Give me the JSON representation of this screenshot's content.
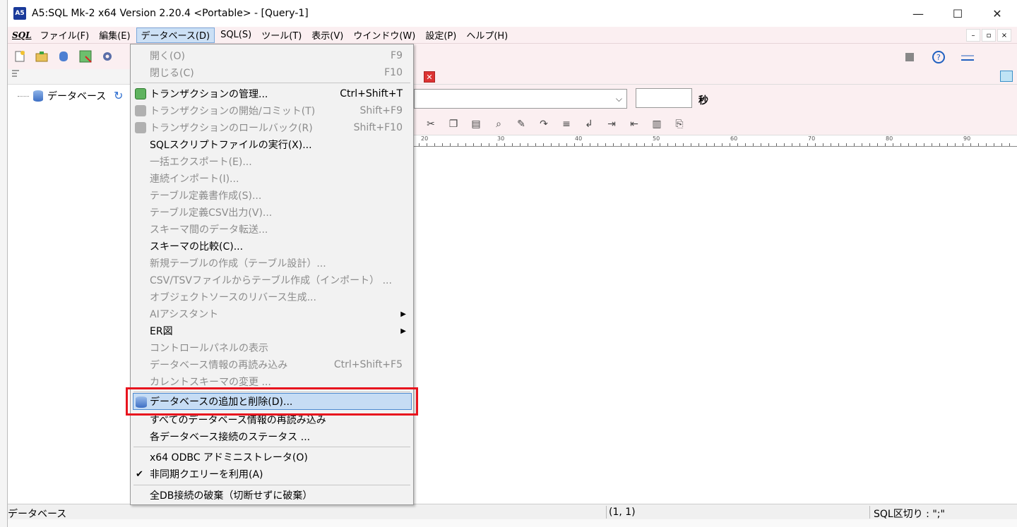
{
  "window": {
    "title": "A5:SQL Mk-2 x64 Version 2.20.4 <Portable> - [Query-1]",
    "app_icon_text": "A5",
    "controls": {
      "minimize": "—",
      "maximize": "☐",
      "close": "✕"
    }
  },
  "menubar": {
    "sql_icon": "SQL",
    "items": [
      {
        "label": "ファイル(F)"
      },
      {
        "label": "編集(E)"
      },
      {
        "label": "データベース(D)"
      },
      {
        "label": "SQL(S)"
      },
      {
        "label": "ツール(T)"
      },
      {
        "label": "表示(V)"
      },
      {
        "label": "ウインドウ(W)"
      },
      {
        "label": "設定(P)"
      },
      {
        "label": "ヘルプ(H)"
      }
    ],
    "mdi": {
      "minimize": "–",
      "restore": "▫",
      "close": "×"
    }
  },
  "tree": {
    "root_label": "データベース",
    "refresh_icon": "↻"
  },
  "query": {
    "timeout_unit": "秒",
    "ruler_ticks": [
      "20",
      "30",
      "40",
      "50",
      "60",
      "70",
      "80",
      "90"
    ]
  },
  "dropdown": {
    "items": [
      {
        "label": "開く(O)",
        "shortcut": "F9",
        "disabled": true
      },
      {
        "label": "閉じる(C)",
        "shortcut": "F10",
        "disabled": true
      },
      {
        "label": "トランザクションの管理...",
        "shortcut": "Ctrl+Shift+T",
        "disabled": false,
        "icon": "transaction-manage-icon"
      },
      {
        "label": "トランザクションの開始/コミット(T)",
        "shortcut": "Shift+F9",
        "disabled": true,
        "icon": "transaction-commit-icon"
      },
      {
        "label": "トランザクションのロールバック(R)",
        "shortcut": "Shift+F10",
        "disabled": true,
        "icon": "transaction-rollback-icon"
      },
      {
        "label": "SQLスクリプトファイルの実行(X)...",
        "shortcut": "",
        "disabled": false
      },
      {
        "label": "一括エクスポート(E)...",
        "shortcut": "",
        "disabled": true
      },
      {
        "label": "連続インポート(I)...",
        "shortcut": "",
        "disabled": true
      },
      {
        "label": "テーブル定義書作成(S)...",
        "shortcut": "",
        "disabled": true
      },
      {
        "label": "テーブル定義CSV出力(V)...",
        "shortcut": "",
        "disabled": true
      },
      {
        "label": "スキーマ間のデータ転送...",
        "shortcut": "",
        "disabled": true
      },
      {
        "label": "スキーマの比較(C)...",
        "shortcut": "",
        "disabled": false
      },
      {
        "label": "新規テーブルの作成（テーブル設計）...",
        "shortcut": "",
        "disabled": true
      },
      {
        "label": "CSV/TSVファイルからテーブル作成（インポート） ...",
        "shortcut": "",
        "disabled": true
      },
      {
        "label": "オブジェクトソースのリバース生成...",
        "shortcut": "",
        "disabled": true
      },
      {
        "label": "AIアシスタント",
        "shortcut": "",
        "disabled": true,
        "submenu": "▶"
      },
      {
        "label": "ER図",
        "shortcut": "",
        "disabled": false,
        "submenu": "▶"
      },
      {
        "label": "コントロールパネルの表示",
        "shortcut": "",
        "disabled": true
      },
      {
        "label": "データベース情報の再読み込み",
        "shortcut": "Ctrl+Shift+F5",
        "disabled": true
      },
      {
        "label": "カレントスキーマの変更 ...",
        "shortcut": "",
        "disabled": true
      },
      {
        "label": "データベースの追加と削除(D)...",
        "shortcut": "",
        "disabled": false,
        "highlight": true,
        "icon": "database-icon"
      },
      {
        "label": "すべてのデータベース情報の再読み込み",
        "shortcut": "",
        "disabled": false
      },
      {
        "label": "各データベース接続のステータス ...",
        "shortcut": "",
        "disabled": false
      },
      {
        "label": "x64 ODBC アドミニストレータ(O)",
        "shortcut": "",
        "disabled": false
      },
      {
        "label": "非同期クエリーを利用(A)",
        "shortcut": "",
        "disabled": false,
        "checked": "✔"
      },
      {
        "label": "全DB接続の破棄（切断せずに破棄）",
        "shortcut": "",
        "disabled": false
      }
    ]
  },
  "statusbar": {
    "left": "データベース",
    "position": "(1, 1)",
    "delimiter": "SQL区切り : \";\""
  }
}
